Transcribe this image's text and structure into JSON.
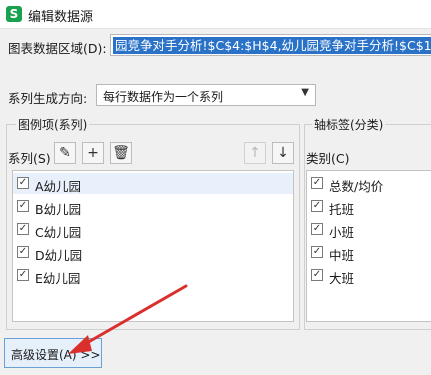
{
  "window": {
    "app_icon_letter": "S",
    "title": "编辑数据源"
  },
  "range": {
    "label": "图表数据区域(D):",
    "value": "园竞争对手分析!$C$4:$H$4,幼儿园竞争对手分析!$C$10:$H"
  },
  "direction": {
    "label": "系列生成方向:",
    "selected": "每行数据作为一个系列",
    "arrow": "▼"
  },
  "legend": {
    "group_title": "图例项(系列)",
    "series_label": "系列(S)",
    "buttons": {
      "edit": "✎",
      "add": "+",
      "delete": "🗑",
      "up": "↑",
      "down": "↓"
    },
    "items": [
      {
        "label": "A幼儿园",
        "checked": "✓"
      },
      {
        "label": "B幼儿园",
        "checked": "✓"
      },
      {
        "label": "C幼儿园",
        "checked": "✓"
      },
      {
        "label": "D幼儿园",
        "checked": "✓"
      },
      {
        "label": "E幼儿园",
        "checked": "✓"
      }
    ]
  },
  "axis": {
    "group_title": "轴标签(分类)",
    "category_label": "类别(C)",
    "items": [
      {
        "label": "总数/均价",
        "checked": "✓"
      },
      {
        "label": "托班",
        "checked": "✓"
      },
      {
        "label": "小班",
        "checked": "✓"
      },
      {
        "label": "中班",
        "checked": "✓"
      },
      {
        "label": "大班",
        "checked": "✓"
      }
    ]
  },
  "advanced": {
    "label": "高级设置(A) >>"
  },
  "colors": {
    "accent": "#2a72c8",
    "annotation_arrow": "#d9302c",
    "app_icon": "#1aa14f"
  }
}
